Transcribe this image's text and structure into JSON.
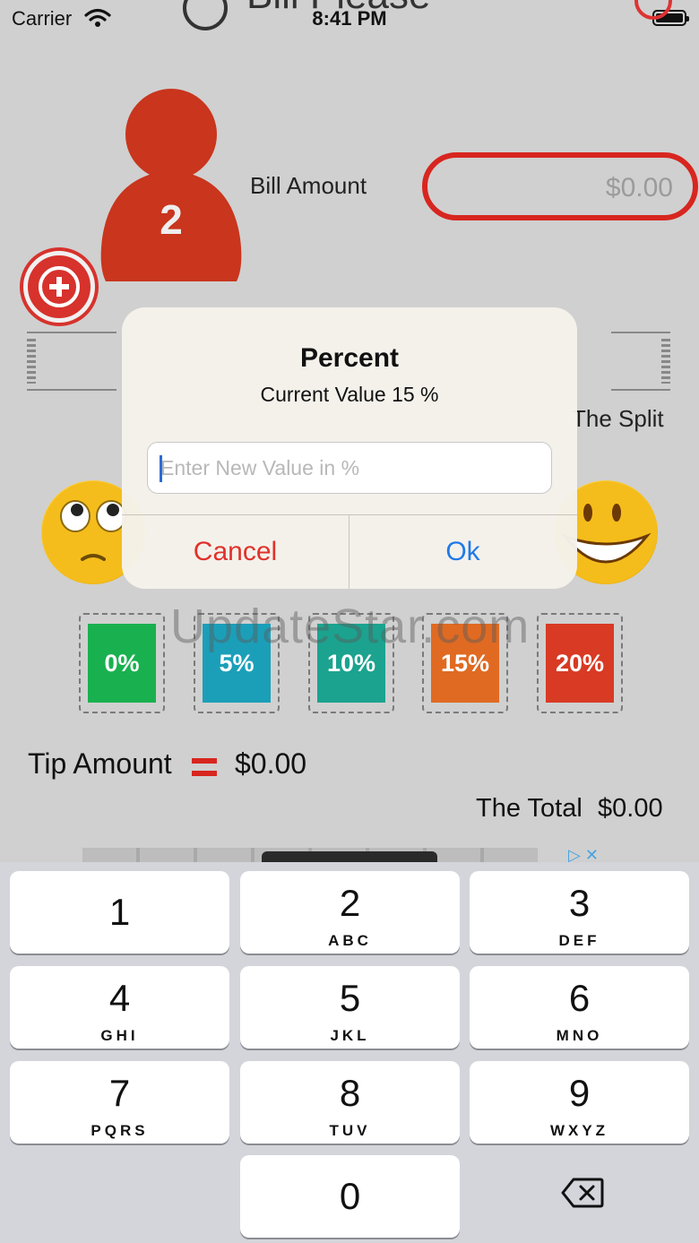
{
  "status_bar": {
    "carrier": "Carrier",
    "time": "8:41 PM"
  },
  "app": {
    "title": "Bill Please",
    "person_count": "2",
    "bill_label": "Bill Amount",
    "bill_value": "$0.00",
    "split_label": "The Split",
    "tips": [
      {
        "label": "0%",
        "color": "#19b14f"
      },
      {
        "label": "5%",
        "color": "#1b9fb9"
      },
      {
        "label": "10%",
        "color": "#1ba38f"
      },
      {
        "label": "15%",
        "color": "#e06a22"
      },
      {
        "label": "20%",
        "color": "#d83a24"
      }
    ],
    "tip_amount_label": "Tip Amount",
    "tip_amount_value": "$0.00",
    "total_label": "The Total",
    "total_value": "$0.00",
    "watermark": "UpdateStar.com",
    "ad_icons": "▷ ✕"
  },
  "alert": {
    "title": "Percent",
    "message": "Current Value 15 %",
    "input_placeholder": "Enter New Value in %",
    "input_value": "",
    "cancel_label": "Cancel",
    "ok_label": "Ok"
  },
  "keyboard": {
    "keys": [
      {
        "digit": "1",
        "letters": ""
      },
      {
        "digit": "2",
        "letters": "ABC"
      },
      {
        "digit": "3",
        "letters": "DEF"
      },
      {
        "digit": "4",
        "letters": "GHI"
      },
      {
        "digit": "5",
        "letters": "JKL"
      },
      {
        "digit": "6",
        "letters": "MNO"
      },
      {
        "digit": "7",
        "letters": "PQRS"
      },
      {
        "digit": "8",
        "letters": "TUV"
      },
      {
        "digit": "9",
        "letters": "WXYZ"
      },
      {
        "digit": "0",
        "letters": ""
      }
    ],
    "delete_icon": "backspace-icon"
  },
  "colors": {
    "accent_red": "#d7261f",
    "ok_blue": "#1f7ae8",
    "cancel_red": "#e0322a"
  }
}
